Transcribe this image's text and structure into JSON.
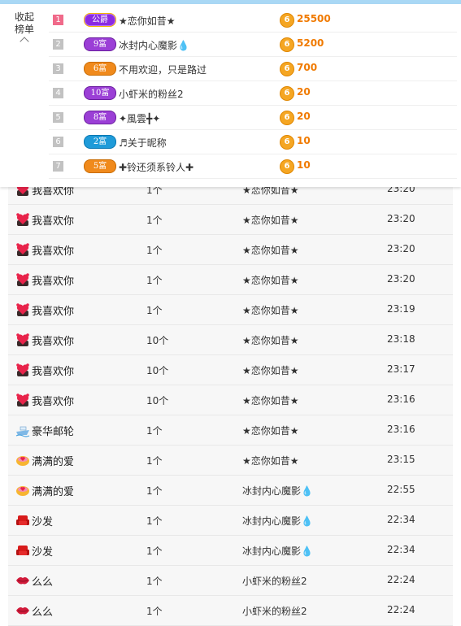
{
  "colors": {
    "accent_orange": "#f07a00",
    "rank_first": "#f06a8a",
    "rank_other": "#c2c2c2",
    "top_bar": "#a9d8f5"
  },
  "ranking": {
    "collapse_label_line1": "收起",
    "collapse_label_line2": "榜单",
    "rows": [
      {
        "rank": "1",
        "badge": "公爵",
        "badge_style": "gold",
        "name": "★恋你如昔★",
        "coin": "6",
        "score": "25500"
      },
      {
        "rank": "2",
        "badge": "9富",
        "badge_style": "purple",
        "name": "冰封内心魔影💧",
        "coin": "6",
        "score": "5200"
      },
      {
        "rank": "3",
        "badge": "6富",
        "badge_style": "orange",
        "name": "不用欢迎，只是路过",
        "coin": "6",
        "score": "700"
      },
      {
        "rank": "4",
        "badge": "10富",
        "badge_style": "purple",
        "name": "小虾米的粉丝2",
        "coin": "6",
        "score": "20"
      },
      {
        "rank": "5",
        "badge": "8富",
        "badge_style": "purple",
        "name": "✦風雲╋✦",
        "coin": "6",
        "score": "20"
      },
      {
        "rank": "6",
        "badge": "2富",
        "badge_style": "blue",
        "name": "♬关于昵称",
        "coin": "6",
        "score": "10"
      },
      {
        "rank": "7",
        "badge": "5富",
        "badge_style": "orange",
        "name": "✚铃还须系铃人✚",
        "coin": "6",
        "score": "10"
      }
    ]
  },
  "gifts": [
    {
      "icon": "heart-bear-icon",
      "name": "我喜欢你",
      "qty": "1个",
      "to": "★恋你如昔★",
      "time": "23:20"
    },
    {
      "icon": "heart-bear-icon",
      "name": "我喜欢你",
      "qty": "1个",
      "to": "★恋你如昔★",
      "time": "23:20"
    },
    {
      "icon": "heart-bear-icon",
      "name": "我喜欢你",
      "qty": "1个",
      "to": "★恋你如昔★",
      "time": "23:20"
    },
    {
      "icon": "heart-bear-icon",
      "name": "我喜欢你",
      "qty": "1个",
      "to": "★恋你如昔★",
      "time": "23:20"
    },
    {
      "icon": "heart-bear-icon",
      "name": "我喜欢你",
      "qty": "1个",
      "to": "★恋你如昔★",
      "time": "23:19"
    },
    {
      "icon": "heart-bear-icon",
      "name": "我喜欢你",
      "qty": "10个",
      "to": "★恋你如昔★",
      "time": "23:18"
    },
    {
      "icon": "heart-bear-icon",
      "name": "我喜欢你",
      "qty": "10个",
      "to": "★恋你如昔★",
      "time": "23:17"
    },
    {
      "icon": "heart-bear-icon",
      "name": "我喜欢你",
      "qty": "10个",
      "to": "★恋你如昔★",
      "time": "23:16"
    },
    {
      "icon": "cruise-ship-icon",
      "name": "豪华邮轮",
      "qty": "1个",
      "to": "★恋你如昔★",
      "time": "23:16"
    },
    {
      "icon": "love-bowl-icon",
      "name": "满满的爱",
      "qty": "1个",
      "to": "★恋你如昔★",
      "time": "23:15"
    },
    {
      "icon": "love-bowl-icon",
      "name": "满满的爱",
      "qty": "1个",
      "to": "冰封内心魔影💧",
      "time": "22:55"
    },
    {
      "icon": "sofa-icon",
      "name": "沙发",
      "qty": "1个",
      "to": "冰封内心魔影💧",
      "time": "22:34"
    },
    {
      "icon": "sofa-icon",
      "name": "沙发",
      "qty": "1个",
      "to": "冰封内心魔影💧",
      "time": "22:34"
    },
    {
      "icon": "kiss-lips-icon",
      "name": "么么",
      "qty": "1个",
      "to": "小虾米的粉丝2",
      "time": "22:24"
    },
    {
      "icon": "kiss-lips-icon",
      "name": "么么",
      "qty": "1个",
      "to": "小虾米的粉丝2",
      "time": "22:24"
    }
  ]
}
